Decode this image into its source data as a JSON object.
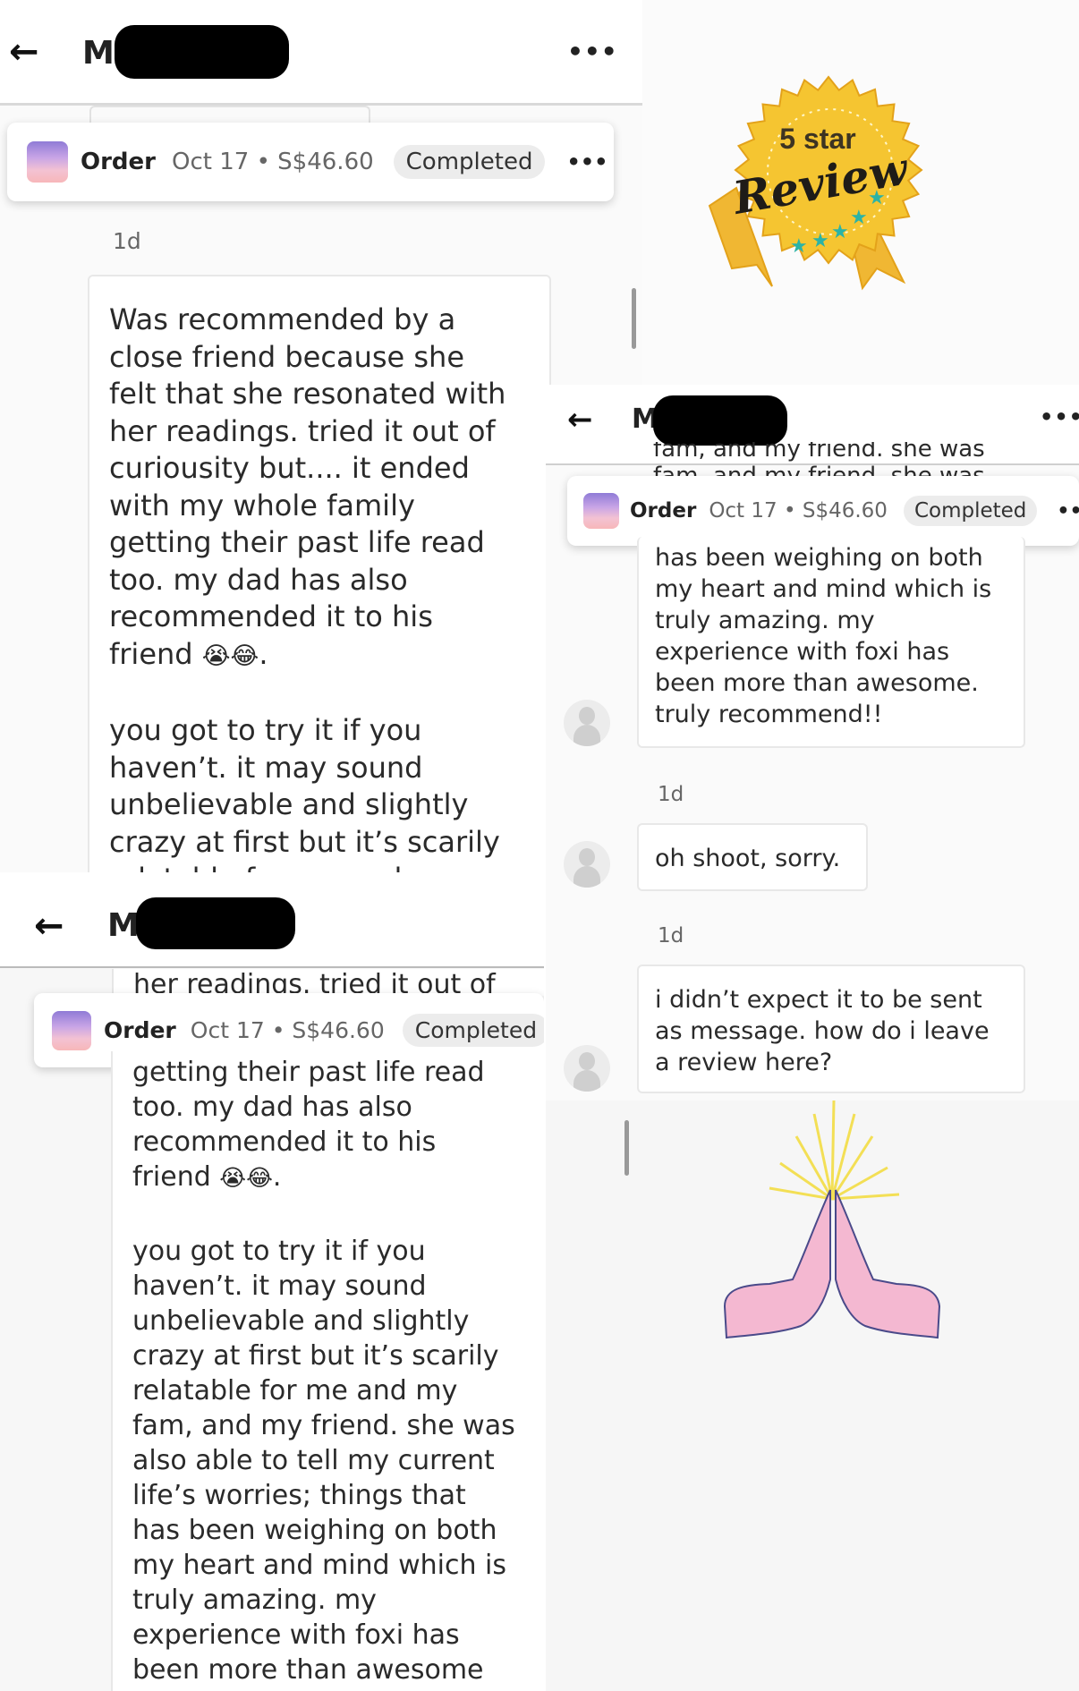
{
  "conversation": {
    "back_icon": "←",
    "name_initial": "M",
    "more_icon": "•••"
  },
  "order": {
    "label": "Order",
    "meta": "Oct 17 • S$46.60",
    "status": "Completed",
    "more_icon": "•••"
  },
  "badge": {
    "top_text": "5 star",
    "script_text": "Review",
    "colors": {
      "gold": "#f5c531",
      "gold_dark": "#e3a21a",
      "ribbon": "#f0b733",
      "star": "#2bb3a6"
    }
  },
  "panel1": {
    "time": "1d",
    "paragraph1_lines": [
      "Was recommended by a",
      "close friend because she",
      "felt that she resonated with",
      "her readings. tried it out of",
      "curiousity but.... it ended",
      "with my whole family",
      "getting their past life read",
      "too. my dad has also",
      "recommended it to his"
    ],
    "friend_line": "friend",
    "emoji1": "😭",
    "emoji2": "😂",
    "period": ".",
    "paragraph2_lines": [
      "you got to try it if you",
      "haven’t. it may sound",
      "unbelievable and slightly",
      "crazy at first but it’s scarily"
    ],
    "cut_line": "relatable for me and my"
  },
  "panel2": {
    "cut_line": "her readings. tried it out of",
    "paragraph1_lines": [
      "getting their past life read",
      "too. my dad has also",
      "recommended it to his"
    ],
    "friend_line": "friend",
    "emoji1": "😭",
    "emoji2": "😂",
    "period": ".",
    "paragraph2_lines": [
      "you got to try it if you",
      "haven’t. it may sound",
      "unbelievable and slightly",
      "crazy at first but it’s scarily",
      "relatable for me and my",
      "fam, and my friend. she was",
      "also able to tell my current",
      "life’s worries; things that",
      "has been weighing on both",
      "my heart and mind which is",
      "truly amazing. my",
      "experience with foxi has",
      "been more than awesome"
    ]
  },
  "panel3": {
    "cut_line": "fam, and my friend. she was",
    "message1_lines": [
      "has been weighing on both",
      "my heart and mind which is",
      "truly amazing. my",
      "experience with foxi has",
      "been more than awesome.",
      "truly recommend!!"
    ],
    "time1": "1d",
    "message2": "oh shoot, sorry.",
    "time2": "1d",
    "message3_lines": [
      "i didn’t expect it to be sent",
      "as message. how do i leave",
      "a review here?"
    ]
  },
  "prayer_hands": {
    "colors": {
      "hands": "#f4b8d1",
      "outline": "#4a4a8a",
      "rays": "#f3df55"
    }
  }
}
